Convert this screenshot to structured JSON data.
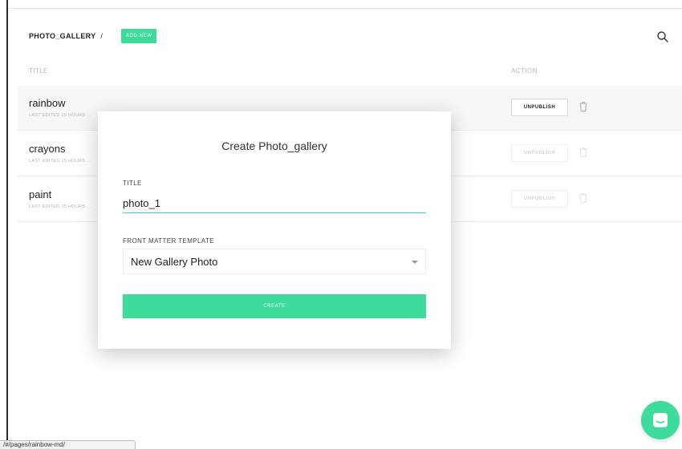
{
  "header": {
    "breadcrumb": "PHOTO_GALLERY",
    "separator": "/",
    "add_new_label": "ADD NEW"
  },
  "table": {
    "columns": {
      "title": "TITLE",
      "action": "ACTION"
    },
    "rows": [
      {
        "title": "rainbow",
        "subtitle": "LAST EDITED 15 HOURS ...",
        "action_label": "UNPUBLISH"
      },
      {
        "title": "crayons",
        "subtitle": "LAST EDITED 15 HOURS ...",
        "action_label": "UNPUBLISH"
      },
      {
        "title": "paint",
        "subtitle": "LAST EDITED 15 HOURS ...",
        "action_label": "UNPUBLISH"
      }
    ]
  },
  "modal": {
    "title": "Create Photo_gallery",
    "title_field_label": "TITLE",
    "title_field_value": "photo_1",
    "template_label": "FRONT MATTER TEMPLATE",
    "template_selected": "New Gallery Photo",
    "create_label": "CREATE"
  },
  "status_bar": {
    "url": "/#/pages/rainbow-md/"
  },
  "icons": {
    "search": "search-icon",
    "trash": "trash-icon",
    "chat": "chat-icon"
  },
  "colors": {
    "accent": "#3ddc9b"
  }
}
